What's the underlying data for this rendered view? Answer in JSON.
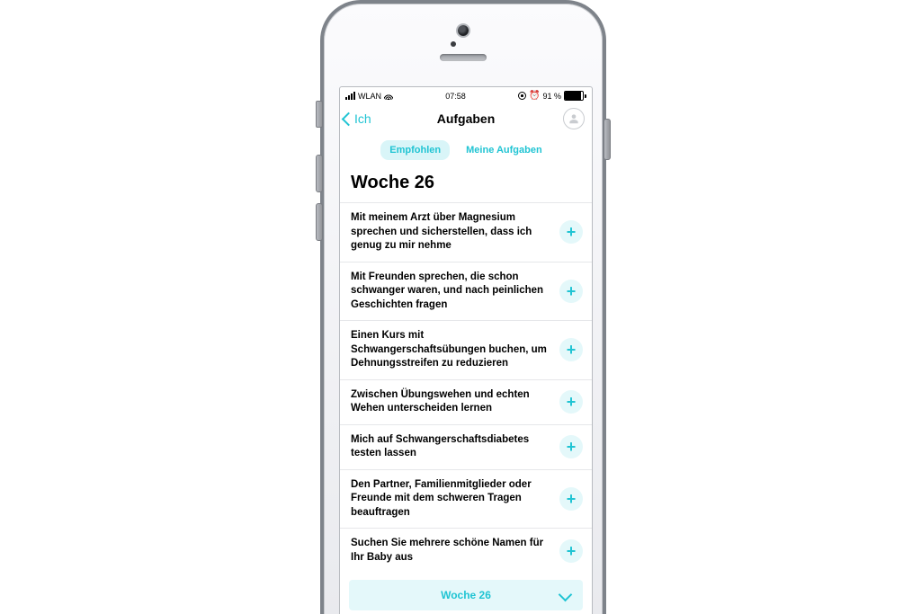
{
  "status": {
    "carrier": "WLAN",
    "time": "07:58",
    "battery": "91 %"
  },
  "nav": {
    "back": "Ich",
    "title": "Aufgaben"
  },
  "tabs": [
    {
      "label": "Empfohlen",
      "active": true
    },
    {
      "label": "Meine Aufgaben",
      "active": false
    }
  ],
  "section": {
    "title": "Woche 26"
  },
  "tasks": [
    "Mit meinem Arzt über Magnesium sprechen und sicherstellen, dass ich genug zu mir nehme",
    "Mit Freunden sprechen, die schon schwanger waren, und nach peinlichen Geschichten fragen",
    "Einen Kurs mit Schwangerschaftsübungen buchen, um Dehnungsstreifen zu reduzieren",
    "Zwischen Übungswehen und echten Wehen unterscheiden lernen",
    "Mich auf Schwangerschaftsdiabetes testen lassen",
    "Den Partner, Familienmitglieder oder Freunde mit dem schweren Tragen beauftragen",
    "Suchen Sie mehrere schöne Namen für Ihr Baby aus"
  ],
  "footer": {
    "label": "Woche 26"
  },
  "colors": {
    "accent": "#20c4d3",
    "accent_bg": "#e4f8fa"
  }
}
